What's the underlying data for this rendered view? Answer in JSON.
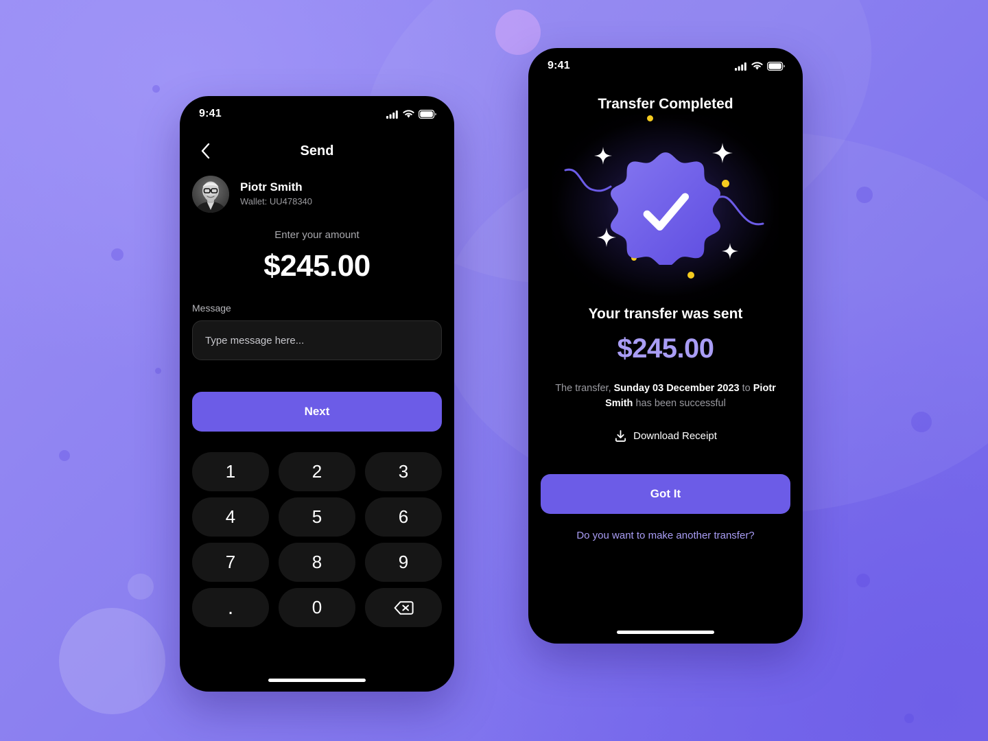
{
  "background": {
    "base_color": "#8b80f0",
    "accent_light": "#b49cf5",
    "accent_soft": "#9f94f7"
  },
  "theme": {
    "screen_bg": "#000000",
    "primary": "#6c5ce7",
    "primary_light": "#a99df5",
    "key_bg": "#161616",
    "muted_text": "#9b9b9f",
    "sparkle": "#ffffff",
    "accent_yellow": "#f5cb1f"
  },
  "send_screen": {
    "status_bar": {
      "time": "9:41",
      "icons": [
        "signal-icon",
        "wifi-icon",
        "battery-icon"
      ]
    },
    "nav": {
      "back_icon": "chevron-left-icon",
      "title": "Send"
    },
    "recipient": {
      "avatar_alt": "avatar",
      "name": "Piotr Smith",
      "wallet": "Wallet: UU478340"
    },
    "amount": {
      "label": "Enter your amount",
      "value": "$245.00"
    },
    "message": {
      "label": "Message",
      "value": "",
      "placeholder": "Type message here..."
    },
    "next_label": "Next",
    "keypad": [
      {
        "label": "1",
        "name": "key-1"
      },
      {
        "label": "2",
        "name": "key-2"
      },
      {
        "label": "3",
        "name": "key-3"
      },
      {
        "label": "4",
        "name": "key-4"
      },
      {
        "label": "5",
        "name": "key-5"
      },
      {
        "label": "6",
        "name": "key-6"
      },
      {
        "label": "7",
        "name": "key-7"
      },
      {
        "label": "8",
        "name": "key-8"
      },
      {
        "label": "9",
        "name": "key-9"
      },
      {
        "label": ".",
        "name": "key-decimal"
      },
      {
        "label": "0",
        "name": "key-0"
      },
      {
        "label": "",
        "name": "key-backspace"
      }
    ]
  },
  "completed_screen": {
    "status_bar": {
      "time": "9:41",
      "icons": [
        "signal-icon",
        "wifi-icon",
        "battery-icon"
      ]
    },
    "title": "Transfer Completed",
    "illustration": {
      "badge_icon": "verified-check-badge-icon",
      "sparkle_count": 4,
      "yellow_dot_count": 4,
      "squiggle_count": 2
    },
    "headline": "Your transfer was sent",
    "amount": "$245.00",
    "description": {
      "part1": "The transfer, ",
      "date": "Sunday 03 December 2023",
      "part2": " to ",
      "name": "Piotr Smith",
      "part3": " has been successful"
    },
    "download_label": "Download Receipt",
    "download_icon": "download-icon",
    "primary_label": "Got It",
    "secondary_label": "Do you want to make another transfer?"
  }
}
